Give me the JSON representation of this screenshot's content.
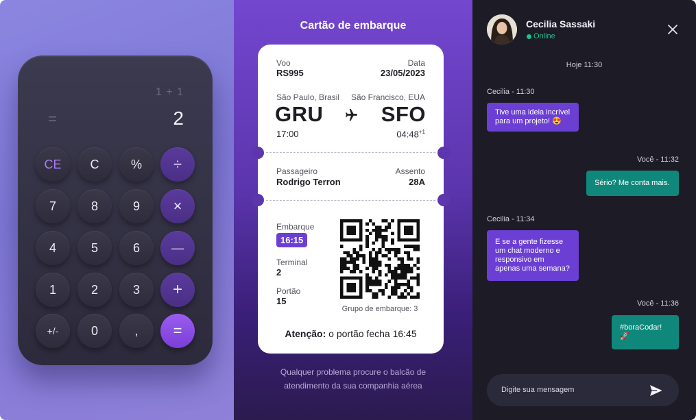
{
  "calculator": {
    "expression": "1 + 1",
    "equals_sign": "=",
    "result": "2",
    "buttons": {
      "ce": "CE",
      "c": "C",
      "percent": "%",
      "divide": "÷",
      "seven": "7",
      "eight": "8",
      "nine": "9",
      "multiply": "×",
      "four": "4",
      "five": "5",
      "six": "6",
      "minus": "—",
      "one": "1",
      "two": "2",
      "three": "3",
      "plus": "+",
      "plus_minus": "+/-",
      "zero": "0",
      "comma": ",",
      "equals": "="
    },
    "accent_color": "#7a3fd8"
  },
  "boarding": {
    "title": "Cartão de embarque",
    "flight_label": "Voo",
    "flight_value": "RS995",
    "date_label": "Data",
    "date_value": "23/05/2023",
    "origin_city": "São Paulo, Brasil",
    "origin_code": "GRU",
    "departure_time": "17:00",
    "destination_city": "São Francisco, EUA",
    "destination_code": "SFO",
    "arrival_time": "04:48",
    "arrival_day_offset": "+1",
    "passenger_label": "Passageiro",
    "passenger_value": "Rodrigo Terron",
    "seat_label": "Assento",
    "seat_value": "28A",
    "boarding_label": "Embarque",
    "boarding_time": "16:15",
    "terminal_label": "Terminal",
    "terminal_value": "2",
    "gate_label": "Portão",
    "gate_value": "15",
    "boarding_group": "Grupo de embarque: 3",
    "warning_label": "Atenção:",
    "warning_text": " o portão fecha 16:45",
    "footer": "Qualquer problema procure o balcão de atendimento da sua companhia aérea"
  },
  "chat": {
    "contact_name": "Cecilia Sassaki",
    "status": "Online",
    "day_separator": "Hoje 11:30",
    "messages": [
      {
        "author_time": "Cecilia - 11:30",
        "text": "Tive uma ideia incrível para um projeto! 😍"
      },
      {
        "author_time": "Você - 11:32",
        "text": "Sério? Me conta mais."
      },
      {
        "author_time": "Cecilia - 11:34",
        "text": "E se a gente fizesse um chat moderno e responsivo em apenas uma semana?"
      },
      {
        "author_time": "Você - 11:36",
        "text": "#boraCodar! 🚀"
      }
    ],
    "input_placeholder": "Digite sua mensagem",
    "incoming_color": "#6b3fd4",
    "outgoing_color": "#10877b"
  }
}
